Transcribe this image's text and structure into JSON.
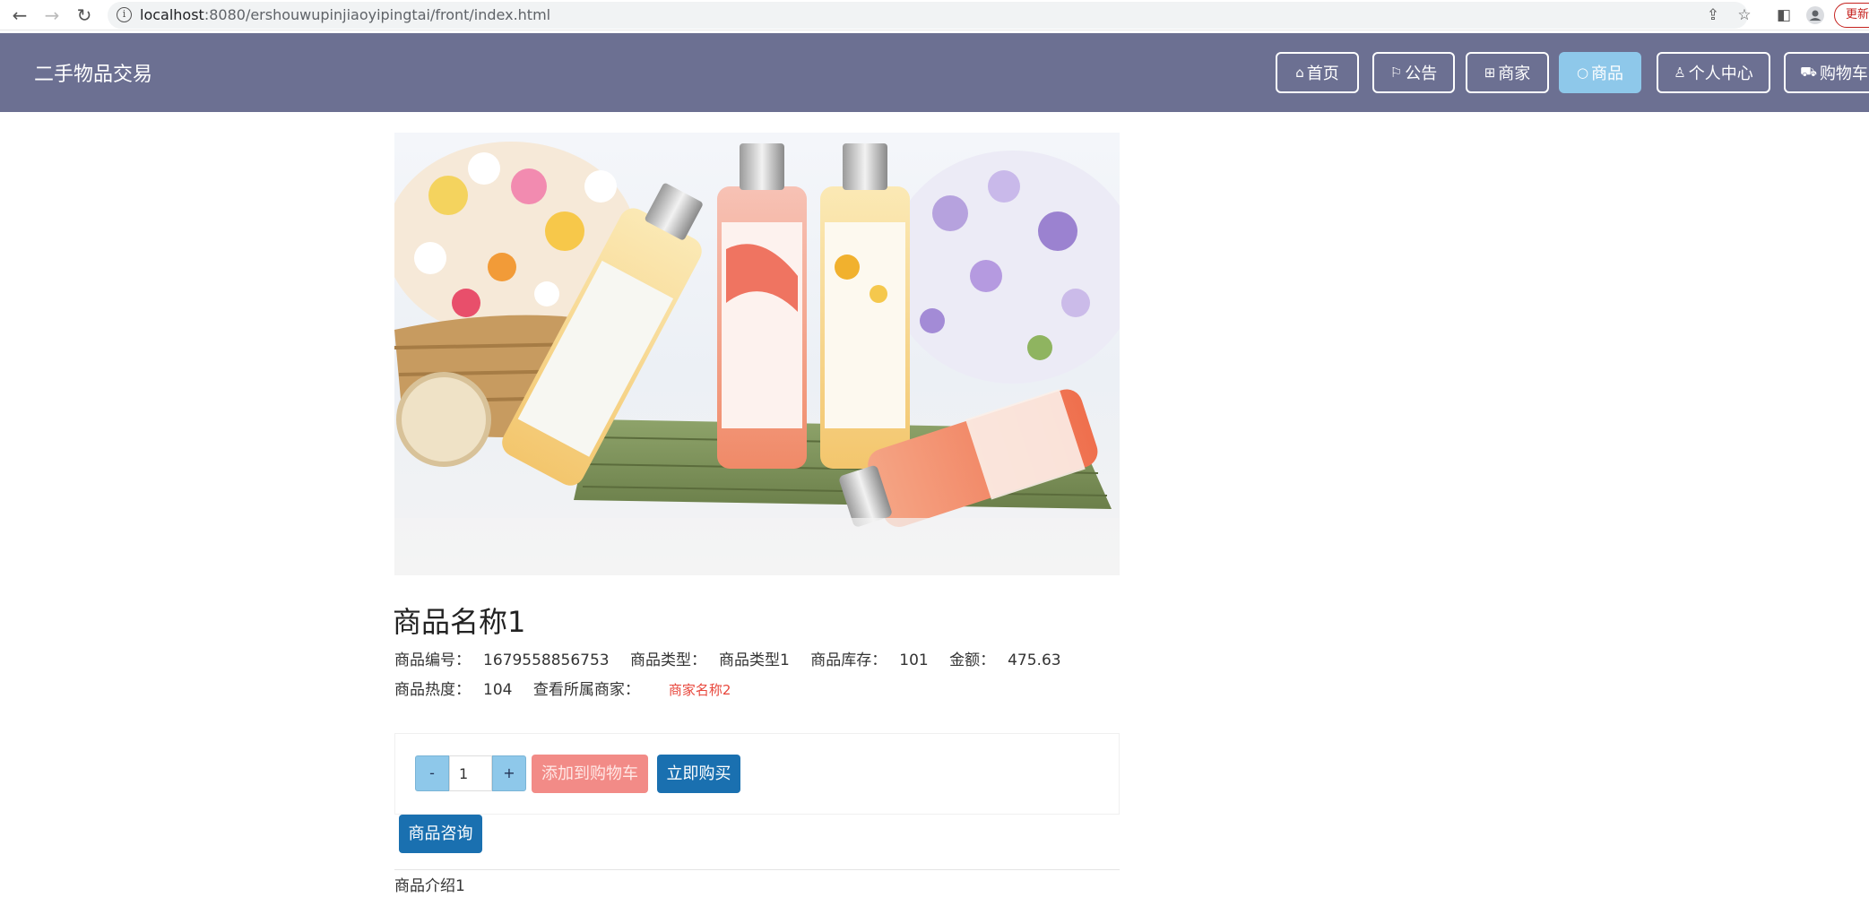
{
  "browser": {
    "url_host": "localhost",
    "url_rest": ":8080/ershouwupinjiaoyipingtai/front/index.html",
    "update_label": "更新"
  },
  "header": {
    "site_title": "二手物品交易",
    "nav": [
      {
        "label": "首页",
        "icon": "home-icon",
        "active": false
      },
      {
        "label": "公告",
        "icon": "flag-icon",
        "active": false
      },
      {
        "label": "商家",
        "icon": "gift-icon",
        "active": false
      },
      {
        "label": "商品",
        "icon": "circle-icon",
        "active": true
      },
      {
        "label": "个人中心",
        "icon": "user-icon",
        "active": false
      },
      {
        "label": "购物车",
        "icon": "cart-icon",
        "active": false
      }
    ],
    "colors": {
      "bar": "#6c7092",
      "active_nav": "#8ec8ea"
    }
  },
  "product": {
    "name": "商品名称1",
    "code_label": "商品编号：",
    "code": "1679558856753",
    "type_label": "商品类型：",
    "type": "商品类型1",
    "stock_label": "商品库存：",
    "stock": "101",
    "price_label": "金额：",
    "price": "475.63",
    "heat_label": "商品热度：",
    "heat": "104",
    "merchant_label": "查看所属商家：",
    "merchant": "商家名称2",
    "intro": "商品介绍1"
  },
  "actions": {
    "minus": "-",
    "plus": "+",
    "quantity": "1",
    "add_to_cart": "添加到购物车",
    "buy_now": "立即购买",
    "consult": "商品咨询"
  }
}
